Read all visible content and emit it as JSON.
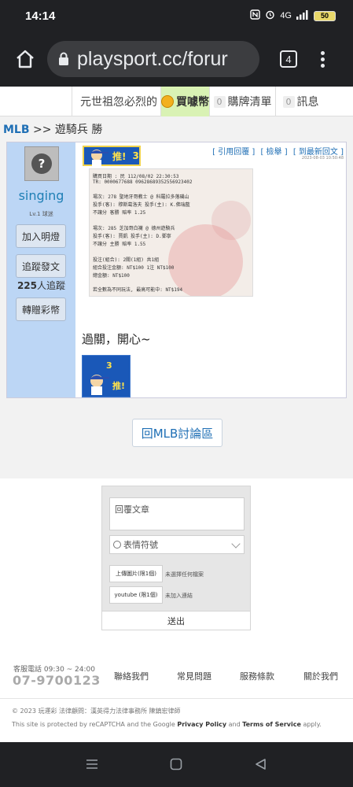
{
  "status_bar": {
    "time": "14:14",
    "network": "4G",
    "battery": "50"
  },
  "browser": {
    "url": "playsport.cc/forur",
    "tab_count": "4"
  },
  "site_nav": {
    "ticker": "元世祖忽必烈的",
    "buy_coin": "買噱幣",
    "cart_count": "0",
    "cart": "購牌清單",
    "msg_count": "0",
    "messages": "訊息"
  },
  "breadcrumb": {
    "section": "MLB",
    "separator": ">>",
    "title": "遊騎兵 勝"
  },
  "post": {
    "username": "singing",
    "level": "Lv.1 球迷",
    "add_friend": "加入明燈",
    "follow_posts": "追蹤發文",
    "follow_count": "225",
    "follow_suffix": "人追蹤",
    "gift_coin": "轉贈彩幣",
    "push_label": "推!",
    "push_count": "3",
    "quote_reply": "[ 引用回覆 ]",
    "report": "[ 檢舉 ]",
    "latest_reply": "[ 到最新回文 ]",
    "date": "2023-08-03 10:50:48",
    "body": "過關，開心~",
    "ticket_lines": [
      "購買日期 : 民 112/08/02 22:30:53",
      "TR: 0000677688 09628689352556923402",
      "場次: 278 聖地牙哥教士 @ 科羅拉多落磯山",
      "投手(客): 穆斯葛洛夫 投手(主): K.佛瑞藍",
      "不讓分 客勝 賠率  1.25",
      "場次: 285 芝加哥白襪 @ 德州遊騎兵",
      "投手(客): 賈凱  投手(主): D.鄧寧",
      "不讓分 主勝 賠率  1.55",
      "投注(組合): 2關(1組) 共1組",
      "組合投注金額: NT$100  1注 NT$100",
      "總金額: NT$100",
      "若全數為不同玩法, 最高可能中: NT$194"
    ]
  },
  "back_link": "回MLB討論區",
  "reply_form": {
    "placeholder": "回覆文章",
    "emoji": "表情符號",
    "upload_image": "上傳圖片(限1個)",
    "upload_image_hint": "未選擇任何檔案",
    "youtube": "youtube (限1個)",
    "youtube_hint": "未加入連結",
    "submit": "送出"
  },
  "footer": {
    "phone_label": "客服電話 09:30 ~ 24:00",
    "phone": "07-9700123",
    "links": [
      "聯絡我們",
      "常見問題",
      "服務條款",
      "關於我們"
    ],
    "copyright": "© 2023 玩運彩 法律顧問：漢英得力法律事務所 陳鎮宏律師",
    "recaptcha_prefix": "This site is protected by reCAPTCHA and the Google ",
    "privacy": "Privacy Policy",
    "and": " and ",
    "terms": "Terms of Service",
    "apply": " apply."
  }
}
